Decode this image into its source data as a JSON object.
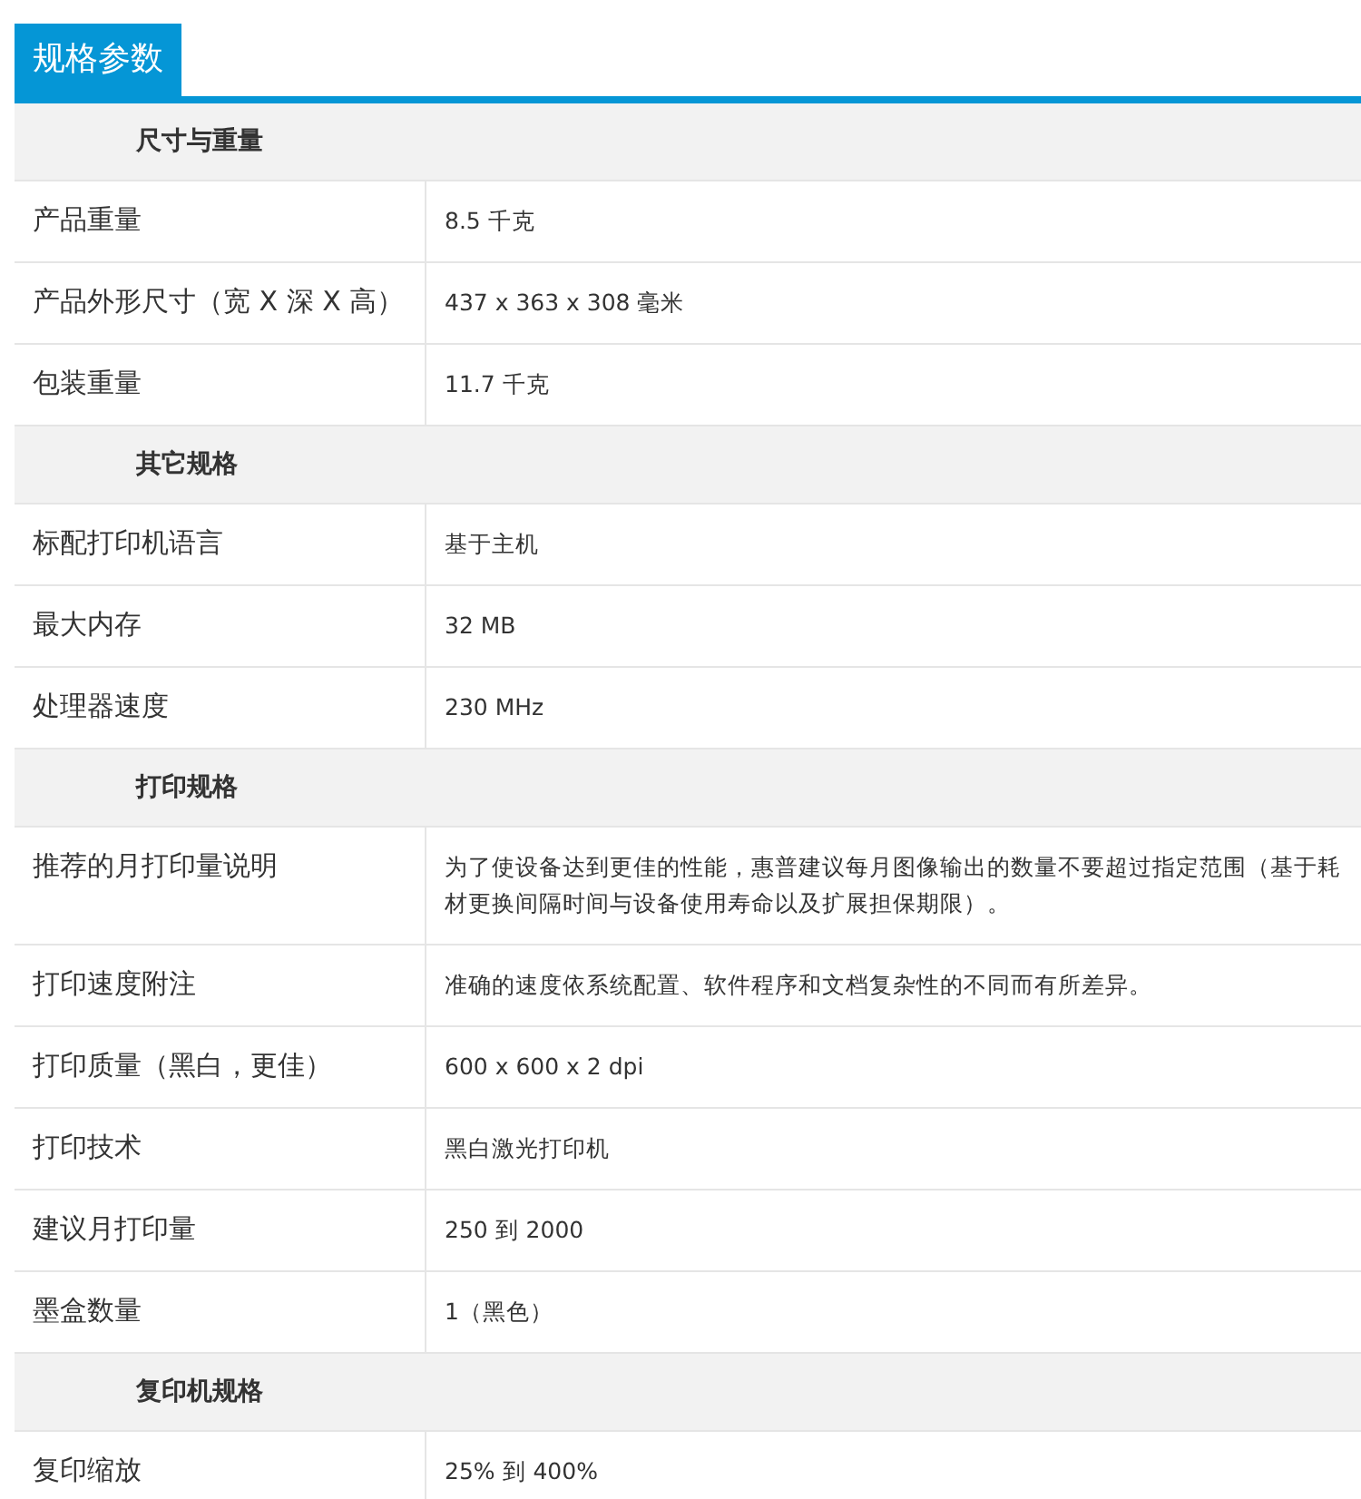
{
  "tab": {
    "label": "规格参数",
    "selected": true
  },
  "sections": [
    {
      "title": "尺寸与重量",
      "rows": [
        {
          "label": "产品重量",
          "value": "8.5 千克"
        },
        {
          "label": "产品外形尺寸（宽 X 深 X 高）",
          "value": "437 x 363 x 308 毫米"
        },
        {
          "label": "包装重量",
          "value": "11.7 千克"
        }
      ]
    },
    {
      "title": "其它规格",
      "rows": [
        {
          "label": "标配打印机语言",
          "value": "基于主机"
        },
        {
          "label": "最大内存",
          "value": "32 MB"
        },
        {
          "label": "处理器速度",
          "value": "230 MHz"
        }
      ]
    },
    {
      "title": "打印规格",
      "rows": [
        {
          "label": "推荐的月打印量说明",
          "value": "为了使设备达到更佳的性能，惠普建议每月图像输出的数量不要超过指定范围（基于耗材更换间隔时间与设备使用寿命以及扩展担保期限）。"
        },
        {
          "label": "打印速度附注",
          "value": "准确的速度依系统配置、软件程序和文档复杂性的不同而有所差异。"
        },
        {
          "label": "打印质量（黑白，更佳）",
          "value": "600 x 600 x 2 dpi"
        },
        {
          "label": "打印技术",
          "value": "黑白激光打印机"
        },
        {
          "label": "建议月打印量",
          "value": "250 到 2000"
        },
        {
          "label": "墨盒数量",
          "value": "1（黑色）"
        }
      ]
    },
    {
      "title": "复印机规格",
      "rows": [
        {
          "label": "复印缩放",
          "value": "25% 到 400%"
        }
      ]
    }
  ]
}
